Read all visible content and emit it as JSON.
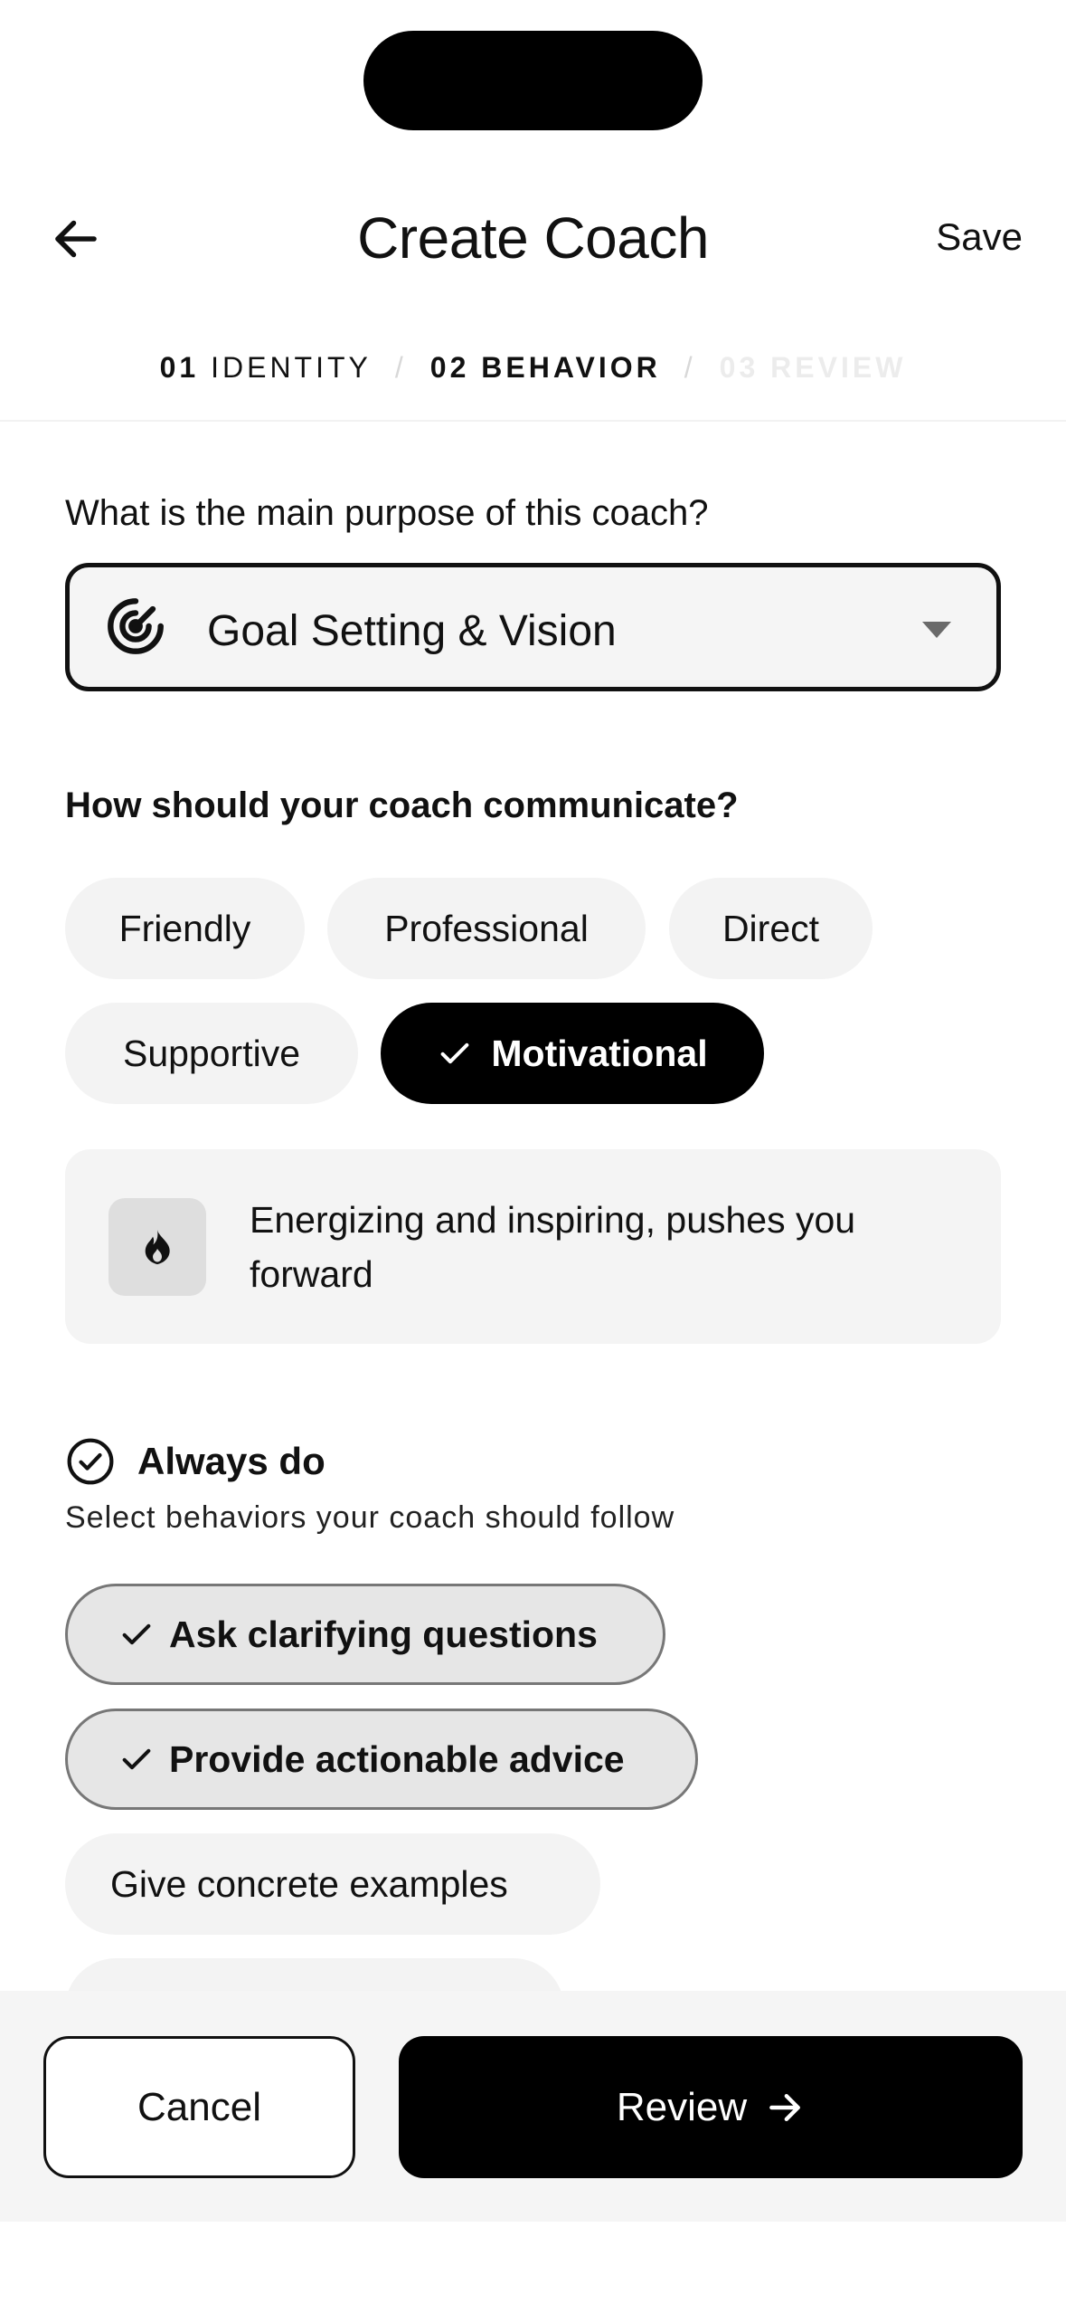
{
  "header": {
    "title": "Create Coach",
    "save_label": "Save"
  },
  "steps": [
    {
      "num": "01",
      "label": "IDENTITY",
      "state": "done"
    },
    {
      "num": "02",
      "label": "BEHAVIOR",
      "state": "active"
    },
    {
      "num": "03",
      "label": "REVIEW",
      "state": "upcoming"
    }
  ],
  "purpose": {
    "question": "What is the main purpose of this coach?",
    "selected": "Goal Setting & Vision",
    "icon": "target-icon"
  },
  "communication": {
    "question": "How should your coach communicate?",
    "options": [
      "Friendly",
      "Professional",
      "Direct",
      "Supportive",
      "Motivational"
    ],
    "selected": "Motivational",
    "description": "Energizing and inspiring, pushes you forward",
    "description_icon": "flame-icon"
  },
  "always_do": {
    "title": "Always do",
    "subtitle": "Select behaviors your coach should follow",
    "items": [
      {
        "label": "Ask clarifying questions",
        "selected": true
      },
      {
        "label": "Provide actionable advice",
        "selected": true
      },
      {
        "label": "Give concrete examples",
        "selected": false
      }
    ]
  },
  "footer": {
    "cancel_label": "Cancel",
    "review_label": "Review"
  },
  "colors": {
    "primary": "#000000",
    "chip_bg": "#f3f3f3",
    "selected_behavior_bg": "#e6e6e6",
    "card_bg": "#f4f4f4"
  }
}
